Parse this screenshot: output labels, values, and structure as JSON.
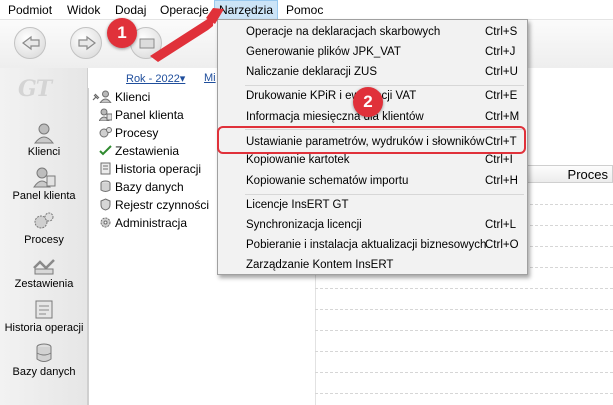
{
  "menubar": {
    "items": [
      {
        "label": "Podmiot"
      },
      {
        "label": "Widok"
      },
      {
        "label": "Dodaj"
      },
      {
        "label": "Operacje"
      },
      {
        "label": "Narzędzia"
      },
      {
        "label": "Pomoc"
      }
    ],
    "active": "Narzędzia"
  },
  "year_bar": {
    "year": "Rok - 2022▾",
    "month": "Mi"
  },
  "logo": "GT",
  "left_nav": {
    "items": [
      {
        "label": "Klienci",
        "icon": "person-icon"
      },
      {
        "label": "Panel klienta",
        "icon": "person-panel-icon"
      },
      {
        "label": "Procesy",
        "icon": "gears-icon"
      },
      {
        "label": "Zestawienia",
        "icon": "checklist-icon"
      },
      {
        "label": "Historia operacji",
        "icon": "history-icon"
      },
      {
        "label": "Bazy danych",
        "icon": "database-icon"
      }
    ]
  },
  "tree": {
    "items": [
      {
        "label": "Klienci",
        "icon": "person-icon"
      },
      {
        "label": "Panel klienta",
        "icon": "person-panel-icon"
      },
      {
        "label": "Procesy",
        "icon": "gears-icon"
      },
      {
        "label": "Zestawienia",
        "icon": "checklist-icon"
      },
      {
        "label": "Historia operacji",
        "icon": "history-icon"
      },
      {
        "label": "Bazy danych",
        "icon": "database-icon"
      },
      {
        "label": "Rejestr czynności",
        "icon": "shield-icon"
      },
      {
        "label": "Administracja",
        "icon": "admin-gear-icon"
      }
    ]
  },
  "grid_header": {
    "label": "Proces"
  },
  "dropdown": {
    "items": [
      {
        "label": "Operacje na deklaracjach skarbowych",
        "shortcut": "Ctrl+S"
      },
      {
        "label": "Generowanie plików JPK_VAT",
        "shortcut": "Ctrl+J"
      },
      {
        "label": "Naliczanie deklaracji ZUS",
        "shortcut": "Ctrl+U"
      },
      {
        "label": "Drukowanie KPiR i ewidencji VAT",
        "shortcut": "Ctrl+E"
      },
      {
        "label": "Informacja miesięczna dla klientów",
        "shortcut": "Ctrl+M"
      },
      {
        "label": "Ustawianie parametrów, wydruków i słowników",
        "shortcut": "Ctrl+T"
      },
      {
        "label": "Kopiowanie kartotek",
        "shortcut": "Ctrl+I"
      },
      {
        "label": "Kopiowanie schematów importu",
        "shortcut": "Ctrl+H"
      },
      {
        "label": "Licencje InsERT GT",
        "shortcut": ""
      },
      {
        "label": "Synchronizacja licencji",
        "shortcut": "Ctrl+L"
      },
      {
        "label": "Pobieranie i instalacja aktualizacji biznesowych",
        "shortcut": "Ctrl+O"
      },
      {
        "label": "Zarządzanie Kontem InsERT",
        "shortcut": ""
      }
    ]
  },
  "annotations": {
    "step1": "1",
    "step2": "2"
  },
  "colors": {
    "accent_red": "#e0313a",
    "menu_active": "#cce4f7",
    "link_blue": "#1f4e9c"
  }
}
